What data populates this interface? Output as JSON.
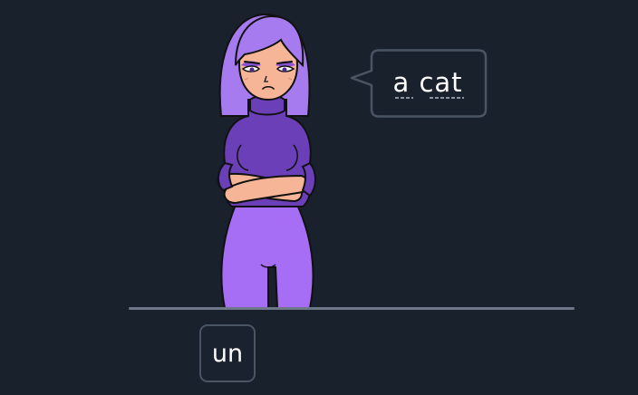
{
  "scene": {
    "speech_text": "a cat",
    "answer_choice": "un"
  },
  "colors": {
    "background": "#19212d",
    "hair": "#a77bf0",
    "sweater": "#6a3fb8",
    "pants": "#a56ef5",
    "skin": "#f5b596",
    "outline": "#111111",
    "bubble_border": "#4a5564",
    "floor_line": "#6e7787"
  }
}
